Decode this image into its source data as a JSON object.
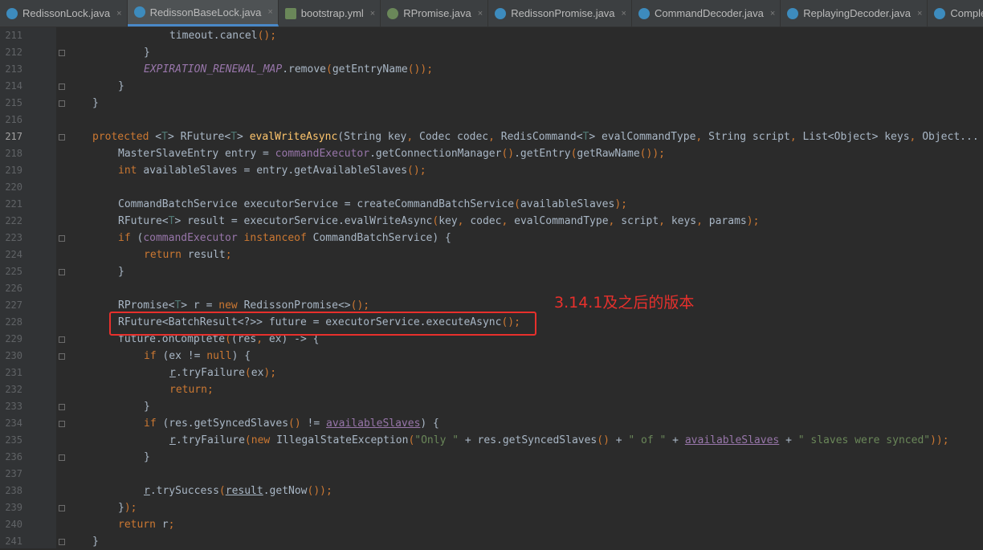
{
  "tabs": [
    {
      "name": "RedissonLock.java",
      "icon": "java-class-icon",
      "active": false
    },
    {
      "name": "RedissonBaseLock.java",
      "icon": "java-class-icon",
      "active": true
    },
    {
      "name": "bootstrap.yml",
      "icon": "yaml-file-icon",
      "active": false
    },
    {
      "name": "RPromise.java",
      "icon": "java-interface-icon",
      "active": false
    },
    {
      "name": "RedissonPromise.java",
      "icon": "java-class-icon",
      "active": false
    },
    {
      "name": "CommandDecoder.java",
      "icon": "java-class-icon",
      "active": false
    },
    {
      "name": "ReplayingDecoder.java",
      "icon": "java-class-icon",
      "active": false
    },
    {
      "name": "Complet",
      "icon": "java-class-icon",
      "active": false
    }
  ],
  "editor": {
    "current_line": "217",
    "lines": [
      {
        "n": "211"
      },
      {
        "n": "212"
      },
      {
        "n": "213"
      },
      {
        "n": "214"
      },
      {
        "n": "215"
      },
      {
        "n": "216"
      },
      {
        "n": "217"
      },
      {
        "n": "218"
      },
      {
        "n": "219"
      },
      {
        "n": "220"
      },
      {
        "n": "221"
      },
      {
        "n": "222"
      },
      {
        "n": "223"
      },
      {
        "n": "224"
      },
      {
        "n": "225"
      },
      {
        "n": "226"
      },
      {
        "n": "227"
      },
      {
        "n": "228"
      },
      {
        "n": "229"
      },
      {
        "n": "230"
      },
      {
        "n": "231"
      },
      {
        "n": "232"
      },
      {
        "n": "233"
      },
      {
        "n": "234"
      },
      {
        "n": "235"
      },
      {
        "n": "236"
      },
      {
        "n": "237"
      },
      {
        "n": "238"
      },
      {
        "n": "239"
      },
      {
        "n": "240"
      },
      {
        "n": "241"
      }
    ]
  },
  "annotation": {
    "text": "3.14.1及之后的版本",
    "color": "#e8302c"
  },
  "colors": {
    "background": "#2b2b2b",
    "gutter": "#313335",
    "keyword": "#cc7832",
    "method": "#ffc66d",
    "field": "#9876aa",
    "string": "#6a8759"
  }
}
